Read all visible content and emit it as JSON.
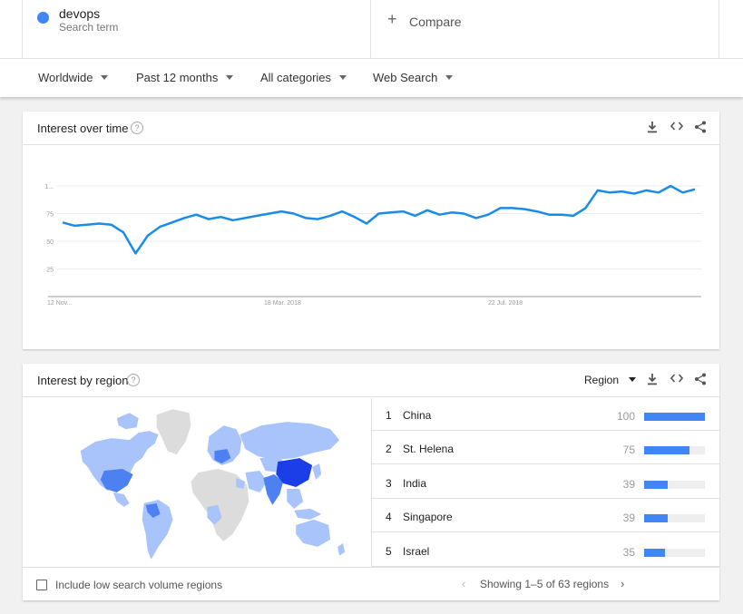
{
  "search": {
    "term": "devops",
    "term_sub": "Search term",
    "term_color": "#4285f4",
    "compare_label": "Compare"
  },
  "filters": {
    "location": "Worldwide",
    "time": "Past 12 months",
    "category": "All categories",
    "type": "Web Search"
  },
  "interest_over_time": {
    "title": "Interest over time",
    "chart_data": {
      "type": "line",
      "y_ticks": [
        "1...",
        "75",
        "50",
        "25"
      ],
      "x_ticks": [
        "12 Nov...",
        "18 Mar. 2018",
        "22 Jul. 2018"
      ],
      "ylim": [
        0,
        100
      ],
      "line_color": "#1a8ce8",
      "values": [
        67,
        64,
        65,
        66,
        65,
        58,
        39,
        55,
        63,
        67,
        71,
        74,
        70,
        72,
        69,
        71,
        73,
        75,
        77,
        75,
        71,
        70,
        73,
        77,
        72,
        66,
        75,
        76,
        77,
        73,
        78,
        74,
        76,
        75,
        71,
        74,
        80,
        80,
        79,
        77,
        74,
        74,
        73,
        80,
        96,
        94,
        95,
        93,
        96,
        94,
        100,
        94,
        97
      ]
    }
  },
  "interest_by_region": {
    "title": "Interest by region",
    "view_label": "Region",
    "rows": [
      {
        "rank": "1",
        "name": "China",
        "value": "100",
        "v": 100
      },
      {
        "rank": "2",
        "name": "St. Helena",
        "value": "75",
        "v": 75
      },
      {
        "rank": "3",
        "name": "India",
        "value": "39",
        "v": 39
      },
      {
        "rank": "4",
        "name": "Singapore",
        "value": "39",
        "v": 39
      },
      {
        "rank": "5",
        "name": "Israel",
        "value": "35",
        "v": 35
      }
    ],
    "include_low_label": "Include low search volume regions",
    "pager_text": "Showing 1–5 of 63 regions",
    "map_colors": {
      "high": "#1a3ee8",
      "mid": "#4d80f0",
      "low": "#a8c4fa",
      "none": "#dcdcdc"
    }
  }
}
